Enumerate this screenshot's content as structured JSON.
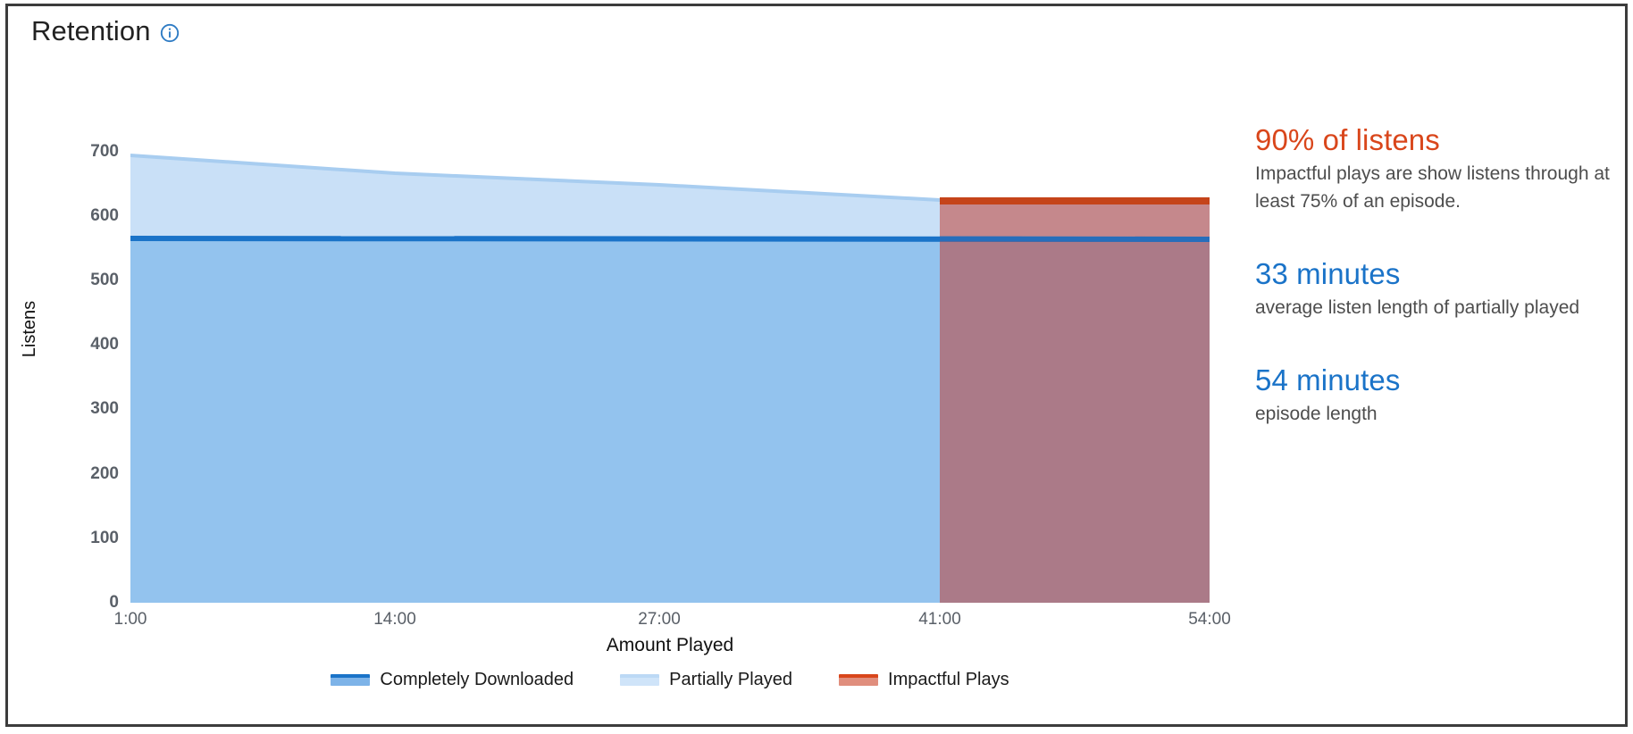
{
  "header": {
    "title": "Retention",
    "info_icon": "info-circle-icon"
  },
  "stats": [
    {
      "value": "90% of listens",
      "color": "#d9461b",
      "description": "Impactful plays are show listens through at least 75% of an episode."
    },
    {
      "value": "33 minutes",
      "color": "#1a73c8",
      "description": "average listen length of partially played"
    },
    {
      "value": "54 minutes",
      "color": "#1a73c8",
      "description": "episode length"
    }
  ],
  "legend": [
    {
      "label": "Completely Downloaded",
      "color": "#1a73c8"
    },
    {
      "label": "Partially Played",
      "color": "#c9e0f7"
    },
    {
      "label": "Impactful Plays",
      "color": "#d9461b"
    }
  ],
  "colors": {
    "partially_played_fill": "#c9e0f7",
    "completely_downloaded_fill": "#93c3ee",
    "completely_downloaded_line": "#1a73c8",
    "impactful_fill": "#c1382a",
    "impactful_line": "#c5441a",
    "partially_played_line": "#a8cdf0",
    "axis_text": "#5a6068",
    "border": "#3c3c3c"
  },
  "chart_data": {
    "type": "area",
    "title": "Retention",
    "xlabel": "Amount Played",
    "ylabel": "Listens",
    "x_tick_labels": [
      "1:00",
      "14:00",
      "27:00",
      "41:00",
      "54:00"
    ],
    "x_tick_minutes": [
      1,
      14,
      27,
      41,
      54
    ],
    "xlim": [
      1,
      54
    ],
    "y_tick_labels": [
      "0",
      "100",
      "200",
      "300",
      "400",
      "500",
      "600",
      "700"
    ],
    "y_ticks": [
      0,
      100,
      200,
      300,
      400,
      500,
      600,
      700
    ],
    "ylim": [
      0,
      700
    ],
    "grid": false,
    "legend_position": "bottom",
    "series": [
      {
        "name": "Partially Played",
        "type": "area",
        "x": [
          1,
          14,
          27,
          41,
          54
        ],
        "values": [
          690,
          662,
          645,
          622,
          622
        ]
      },
      {
        "name": "Completely Downloaded",
        "type": "area-line",
        "x": [
          1,
          14,
          27,
          41,
          54
        ],
        "values": [
          562,
          562,
          562,
          562,
          560
        ]
      },
      {
        "name": "Impactful Plays",
        "type": "area",
        "x": [
          41,
          54
        ],
        "values": [
          622,
          622
        ],
        "note": "shaded region from 41:00 to 54:00, overlaid on the other series"
      }
    ]
  }
}
